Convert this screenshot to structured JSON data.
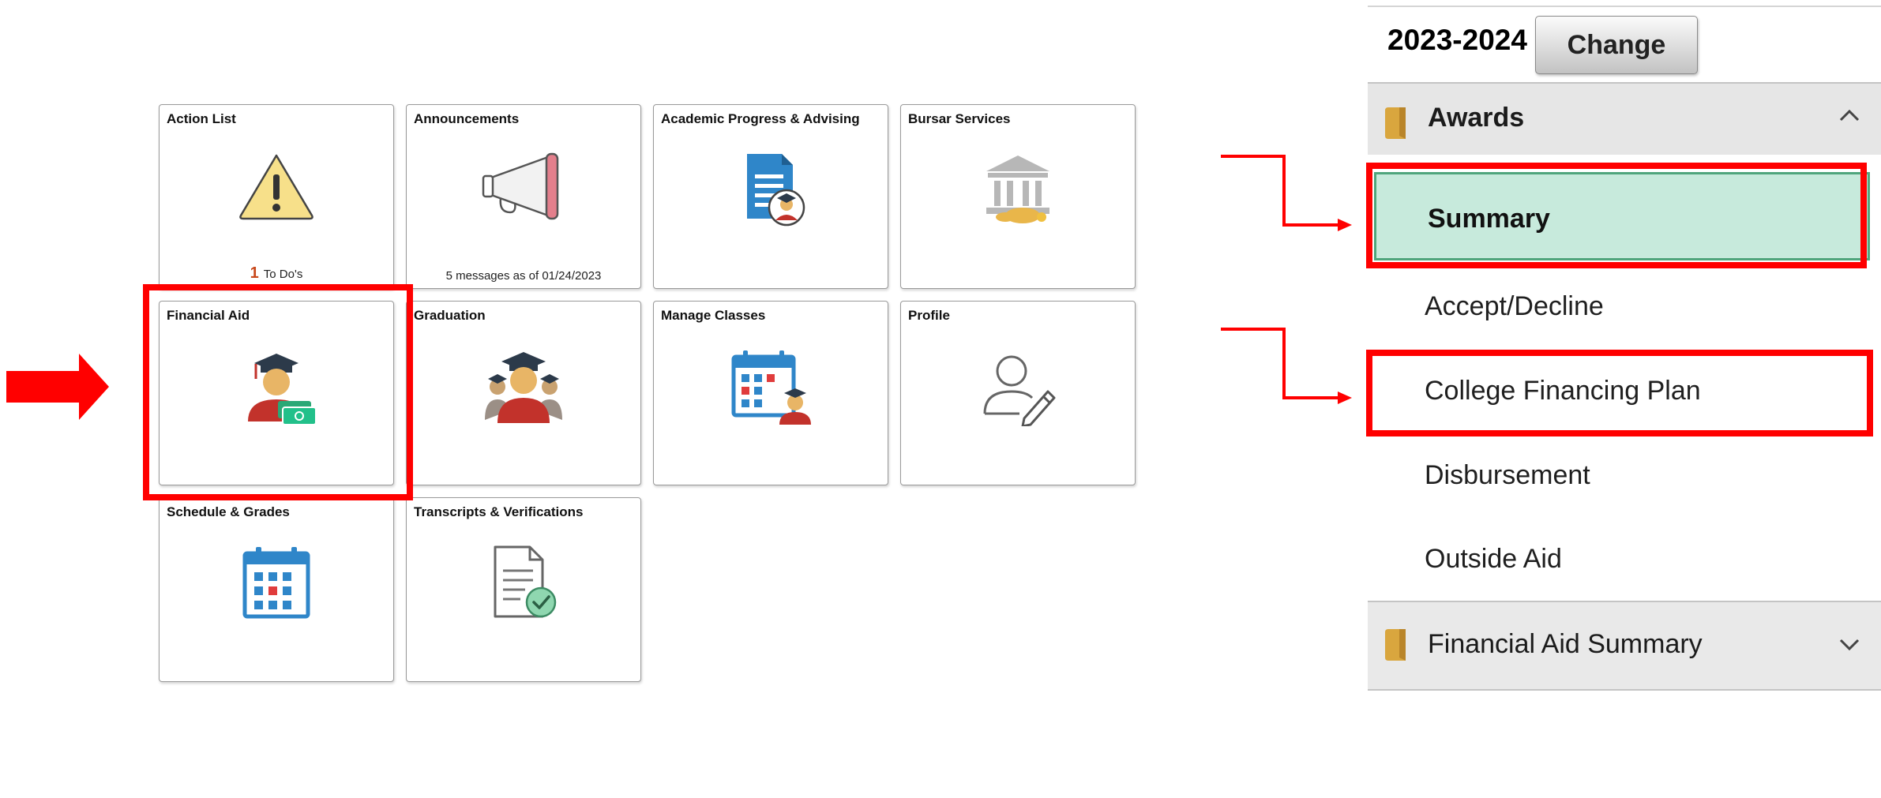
{
  "tiles": [
    {
      "id": "action-list",
      "title": "Action List",
      "todo_count": "1",
      "todo_label": "To Do's"
    },
    {
      "id": "announcements",
      "title": "Announcements",
      "footer": "5 messages as of 01/24/2023"
    },
    {
      "id": "academic-progress",
      "title": "Academic Progress & Advising"
    },
    {
      "id": "bursar-services",
      "title": "Bursar Services"
    },
    {
      "id": "financial-aid",
      "title": "Financial Aid"
    },
    {
      "id": "graduation",
      "title": "Graduation"
    },
    {
      "id": "manage-classes",
      "title": "Manage Classes"
    },
    {
      "id": "profile",
      "title": "Profile"
    },
    {
      "id": "schedule-grades",
      "title": "Schedule & Grades"
    },
    {
      "id": "transcripts",
      "title": "Transcripts & Verifications"
    }
  ],
  "panel": {
    "aid_year": "2023-2024",
    "change_label": "Change",
    "awards": {
      "label": "Awards",
      "items": [
        "Summary",
        "Accept/Decline",
        "College Financing Plan",
        "Disbursement",
        "Outside Aid"
      ],
      "selected": "Summary"
    },
    "financial_aid_summary_label": "Financial Aid Summary"
  },
  "colors": {
    "annotation_red": "#ff0000",
    "selected_bg": "#c7eadc",
    "selected_border": "#4fa57c",
    "todo_count": "#c8481b"
  },
  "icons": [
    "warning-icon",
    "megaphone-icon",
    "advising-document-icon",
    "bank-icon",
    "graduate-money-icon",
    "graduates-icon",
    "calendar-student-icon",
    "profile-edit-icon",
    "calendar-icon",
    "document-check-icon",
    "folder-icon",
    "chevron-up-icon",
    "chevron-down-icon",
    "arrow-right-icon"
  ]
}
